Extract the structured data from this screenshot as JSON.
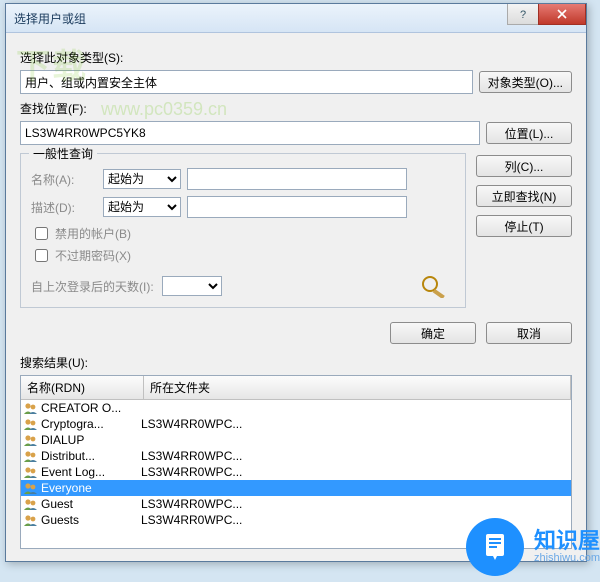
{
  "title": "选择用户或组",
  "labels": {
    "objtype": "选择此对象类型(S):",
    "objval": "用户、组或内置安全主体",
    "location": "查找位置(F):",
    "locval": "LS3W4RR0WPC5YK8",
    "general": "一般性查询",
    "name": "名称(A):",
    "desc": "描述(D):",
    "starts": "起始为",
    "chk1": "禁用的帐户(B)",
    "chk2": "不过期密码(X)",
    "days": "自上次登录后的天数(I):",
    "results": "搜索结果(U):"
  },
  "buttons": {
    "objtype": "对象类型(O)...",
    "location": "位置(L)...",
    "columns": "列(C)...",
    "findnow": "立即查找(N)",
    "stop": "停止(T)",
    "ok": "确定",
    "cancel": "取消"
  },
  "cols": {
    "c1": "名称(RDN)",
    "c2": "所在文件夹"
  },
  "rows": [
    {
      "n": "CREATOR O...",
      "f": ""
    },
    {
      "n": "Cryptogra...",
      "f": "LS3W4RR0WPC..."
    },
    {
      "n": "DIALUP",
      "f": ""
    },
    {
      "n": "Distribut...",
      "f": "LS3W4RR0WPC..."
    },
    {
      "n": "Event Log...",
      "f": "LS3W4RR0WPC..."
    },
    {
      "n": "Everyone",
      "f": "",
      "sel": true
    },
    {
      "n": "Guest",
      "f": "LS3W4RR0WPC..."
    },
    {
      "n": "Guests",
      "f": "LS3W4RR0WPC..."
    }
  ],
  "watermark": {
    "w1": "下载",
    "w2": "www.pc0359.cn"
  },
  "badge": {
    "t": "知识屋",
    "s": "zhishiwu.com"
  }
}
